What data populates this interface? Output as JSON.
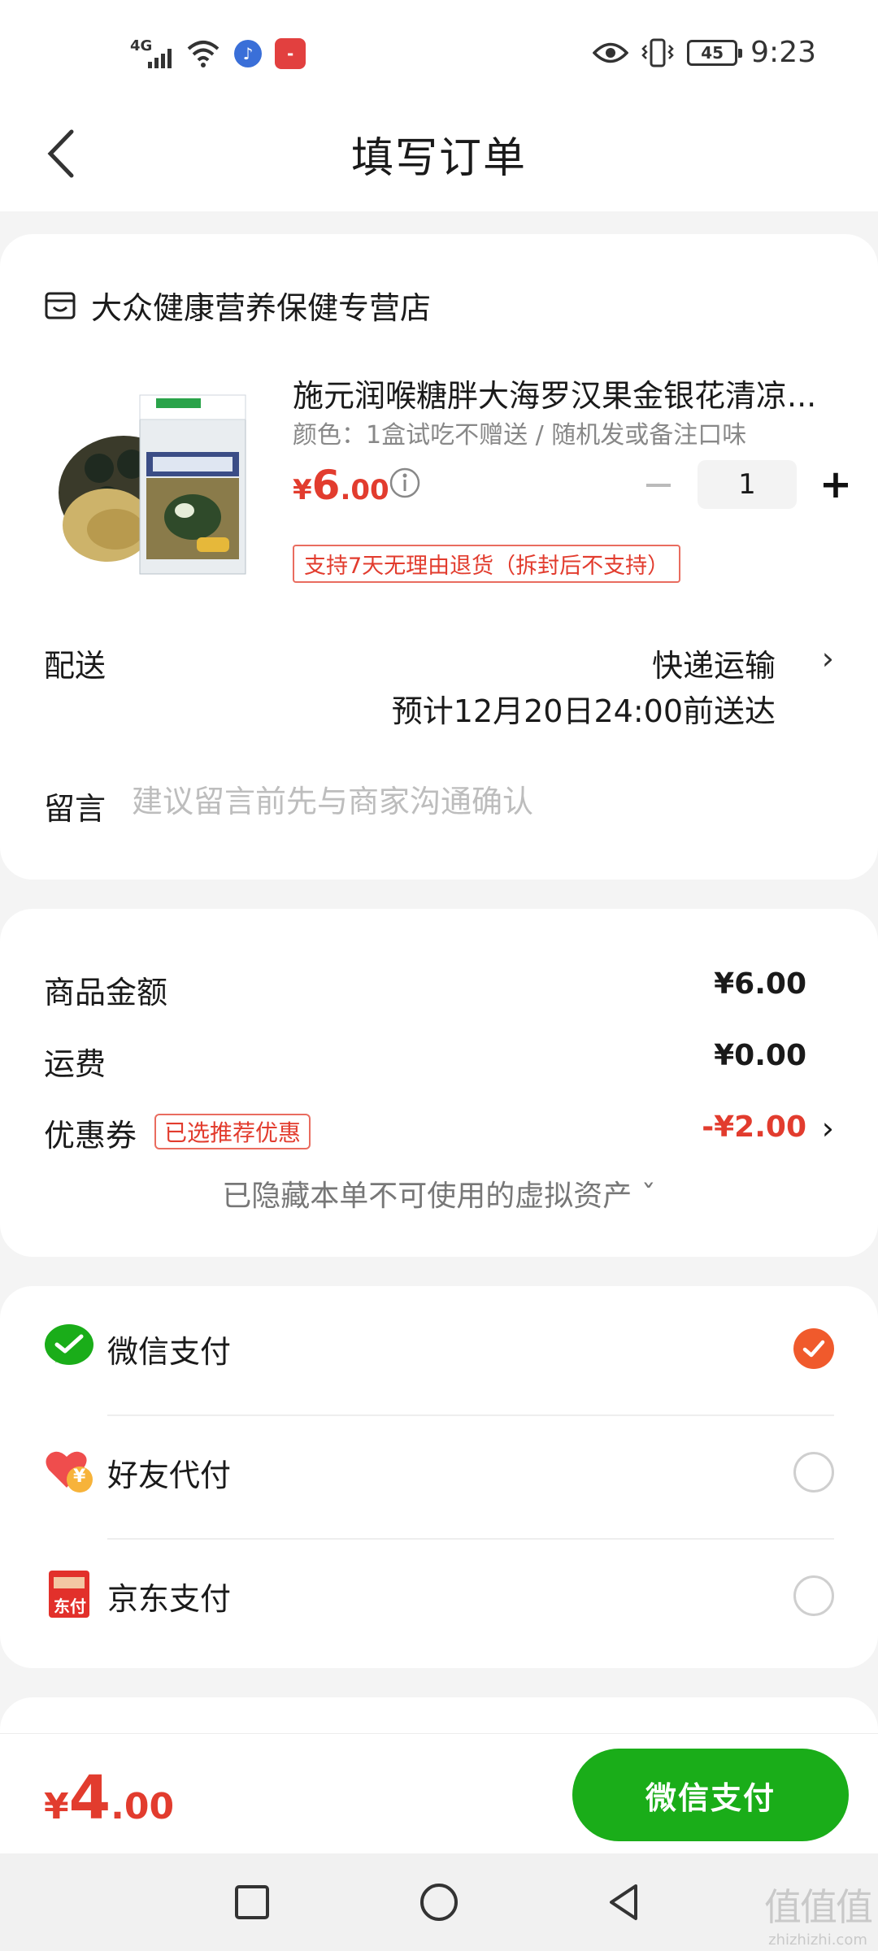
{
  "status_bar": {
    "network": "4G",
    "battery": "45",
    "time": "9:23",
    "icons": [
      "signal-icon",
      "wifi-icon",
      "music-app-icon",
      "huawei-app-icon",
      "eye-icon",
      "vibrate-icon",
      "battery-icon"
    ]
  },
  "header": {
    "title": "填写订单",
    "back_icon": "chevron-left-icon"
  },
  "store": {
    "name": "大众健康营养保健专营店",
    "icon": "store-icon"
  },
  "product": {
    "title": "施元润喉糖胖大海罗汉果金银花清凉...",
    "spec": "颜色：1盒试吃不赠送 / 随机发或备注口味",
    "price_currency": "¥",
    "price_int": "6",
    "price_dec": ".00",
    "quantity": "1",
    "minus": "−",
    "plus": "+",
    "return_policy": "支持7天无理由退货（拆封后不支持）"
  },
  "shipping": {
    "label": "配送",
    "method": "快递运输",
    "eta": "预计12月20日24:00前送达",
    "chevron": "›"
  },
  "note": {
    "label": "留言",
    "placeholder": "建议留言前先与商家沟通确认"
  },
  "pricing": {
    "items": [
      {
        "label": "商品金额",
        "value": "¥6.00"
      },
      {
        "label": "运费",
        "value": "¥0.00"
      }
    ],
    "coupon": {
      "label": "优惠券",
      "badge": "已选推荐优惠",
      "value": "-¥2.00",
      "chevron": "›"
    },
    "hidden_assets": "已隐藏本单不可使用的虚拟资产 ˇ"
  },
  "payment": {
    "options": [
      {
        "name": "微信支付",
        "icon": "wechat-pay-icon",
        "selected": true
      },
      {
        "name": "好友代付",
        "icon": "friend-pay-icon",
        "selected": false
      },
      {
        "name": "京东支付",
        "icon": "jd-pay-icon",
        "selected": false
      }
    ],
    "jd_icon_text": "东付",
    "friend_icon_text": "¥"
  },
  "bottom": {
    "total_currency": "¥",
    "total_int": "4",
    "total_dec": ".00",
    "pay_button": "微信支付"
  },
  "watermark": {
    "glyph": "值值值",
    "site": "zhizhizhi.com"
  },
  "colors": {
    "accent_red": "#e23c2e",
    "wechat_green": "#1aad19",
    "selected_orange": "#f05a2c"
  }
}
